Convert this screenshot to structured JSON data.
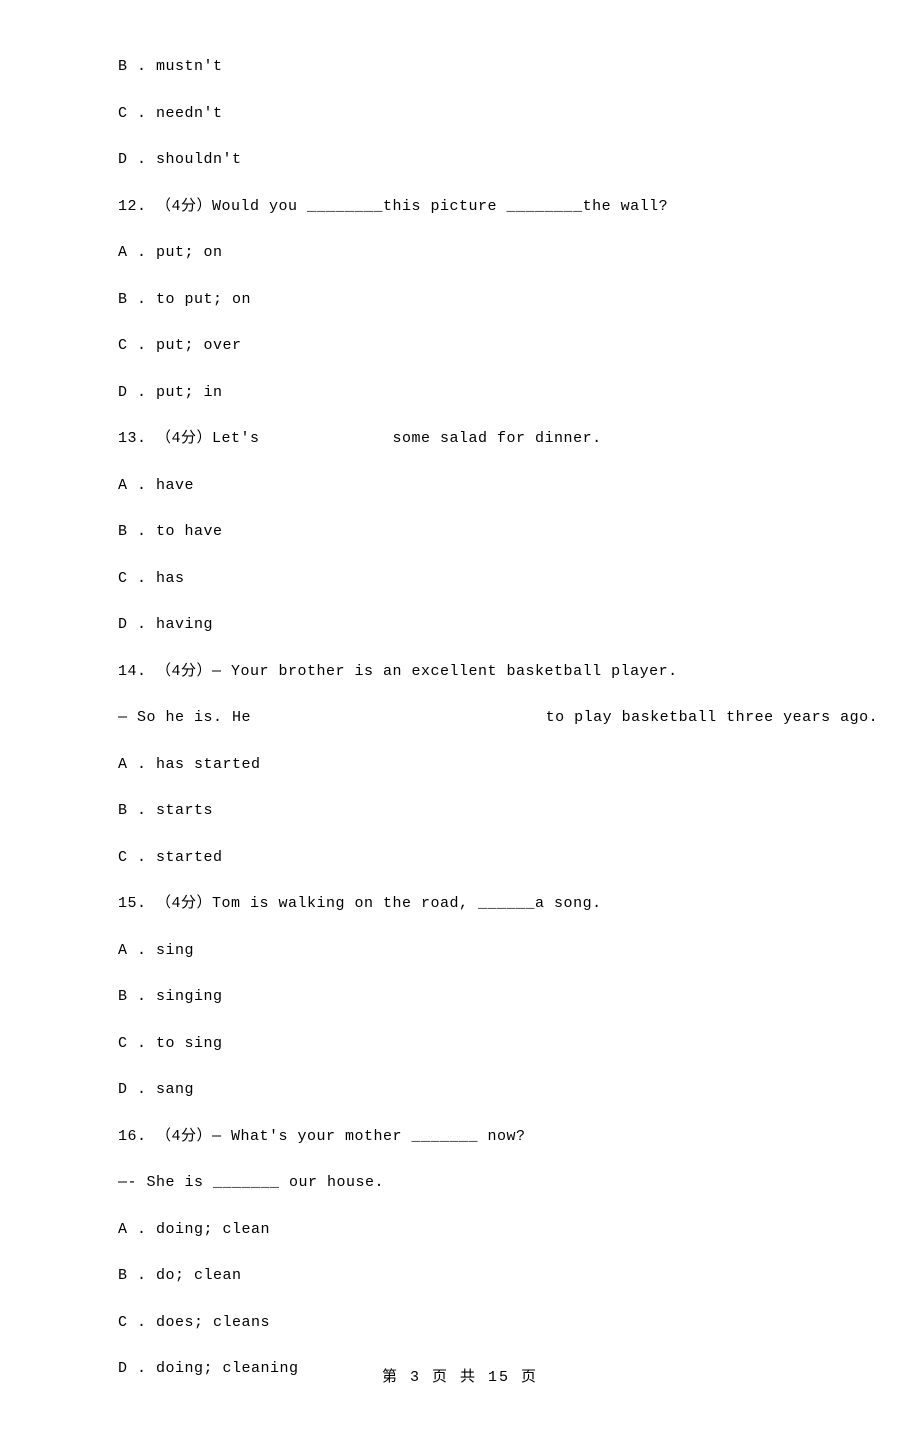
{
  "lines": {
    "l0": "B . mustn't",
    "l1": "C . needn't",
    "l2": "D . shouldn't",
    "l3": "12. （4分）Would you ________this picture ________the wall?",
    "l4": "A . put; on",
    "l5": "B . to put; on",
    "l6": "C . put; over",
    "l7": "D . put; in",
    "l8": "13. （4分）Let's              some salad for dinner.",
    "l9": "A . have",
    "l10": "B . to have",
    "l11": "C . has",
    "l12": "D . having",
    "l13": "14. （4分）— Your brother is an excellent basketball player.",
    "l14": "— So he is. He                               to play basketball three years ago.",
    "l15": "A . has started",
    "l16": "B . starts",
    "l17": "C . started",
    "l18": "15. （4分）Tom is walking on the road, ______a song.",
    "l19": "A . sing",
    "l20": "B . singing",
    "l21": "C . to sing",
    "l22": "D . sang",
    "l23": "16. （4分）— What's your mother _______ now?",
    "l24": "—- She is _______ our house.",
    "l25": "A . doing; clean",
    "l26": "B . do; clean",
    "l27": "C . does; cleans",
    "l28": "D . doing; cleaning"
  },
  "footer": "第 3 页 共 15 页"
}
